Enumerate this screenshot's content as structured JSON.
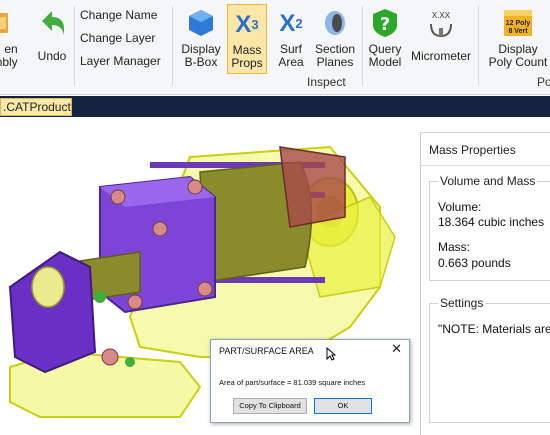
{
  "ribbon": {
    "open_assembly_label": "en\nmbly",
    "undo_label": "Undo",
    "change_name": "Change Name",
    "change_layer": "Change Layer",
    "layer_manager": "Layer Manager",
    "display_bbox_label": "Display\nB-Box",
    "mass_props_label": "Mass\nProps",
    "surf_area_label": "Surf\nArea",
    "section_planes_label": "Section\nPlanes",
    "query_model_label": "Query\nModel",
    "micrometer_label": "Micrometer",
    "micrometer_icon_text": "X.XX",
    "display_poly_count_label": "Display\nPoly Count",
    "poly_icon_text": "12 Poly\n8 Vert",
    "inspect_group_label": "Inspect",
    "next_group_label": "Po",
    "x3_icon_text": "X",
    "x3_sup": "3",
    "x2_icon_text": "X",
    "x2_sup": "2"
  },
  "document_tab": ".CATProduct",
  "panel": {
    "title": "Mass Properties",
    "volume_mass_group": "Volume and Mass",
    "volume_label": "Volume:",
    "volume_value": "18.364  cubic inches",
    "mass_label": "Mass:",
    "mass_value": "0.663 pounds",
    "settings_group": "Settings",
    "settings_note": "\"NOTE: Materials are sp"
  },
  "dialog": {
    "title": "PART/SURFACE AREA",
    "close": "✕",
    "message": "Area of part/surface = 81.039 square inches",
    "copy_button": "Copy To Clipboard",
    "ok_button": "OK"
  },
  "colors": {
    "accent_active": "#fce6a8",
    "tab_strip": "#16233f",
    "model_purple": "#7a3fd1",
    "model_yellow": "#e8ee3c",
    "model_olive": "#8a8a2a"
  }
}
